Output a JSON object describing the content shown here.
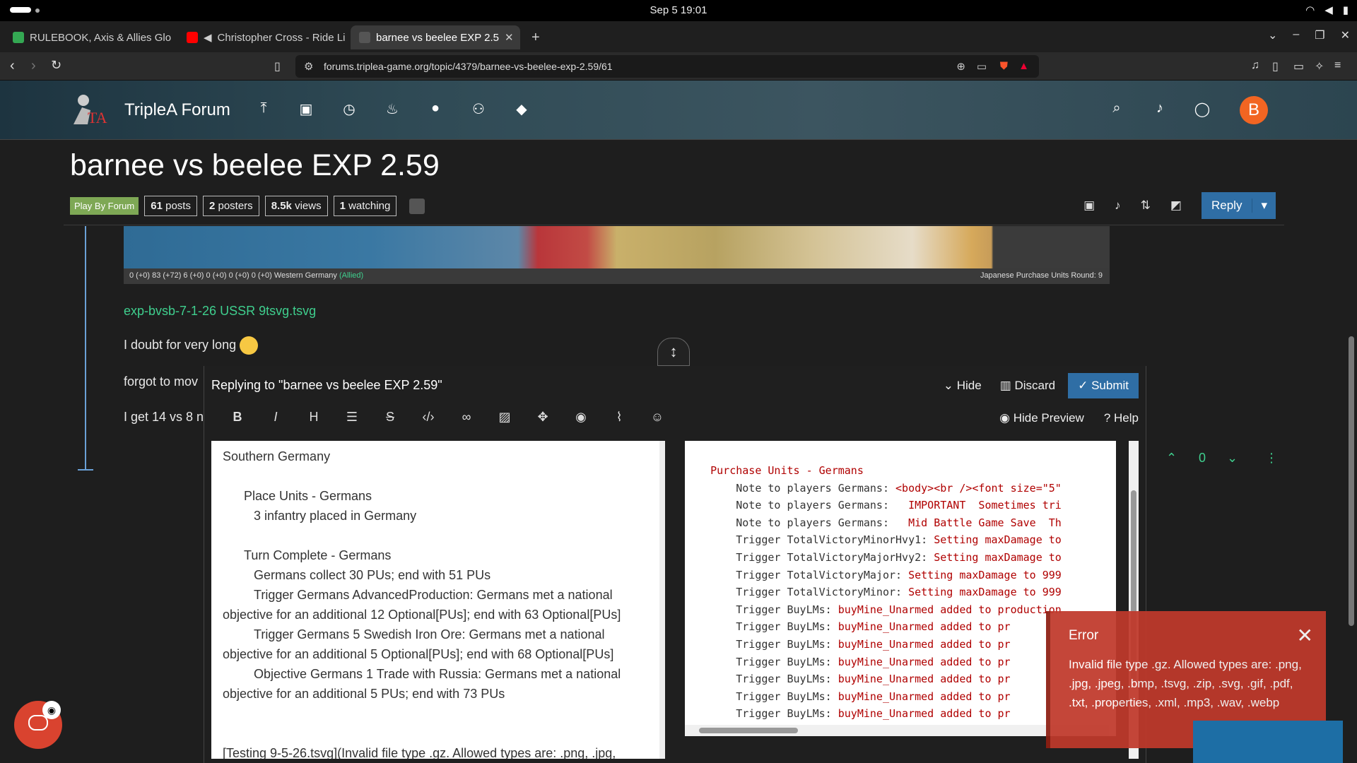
{
  "system": {
    "clock": "Sep 5  19:01"
  },
  "tabs": [
    {
      "label": "RULEBOOK, Axis & Allies Glo",
      "favcolor": "#34a853"
    },
    {
      "label": "Christopher Cross - Ride Li",
      "favcolor": "#ff0000"
    },
    {
      "label": "barnee vs beelee EXP 2.5",
      "favcolor": "#555555"
    }
  ],
  "address": {
    "url": "forums.triplea-game.org/topic/4379/barnee-vs-beelee-exp-2.59/61"
  },
  "forum": {
    "title": "TripleA Forum",
    "avatar_letter": "B"
  },
  "topic": {
    "title": "barnee vs beelee EXP 2.59",
    "category": "Play By Forum",
    "posts_count": "61",
    "posts_label": "posts",
    "posters_count": "2",
    "posters_label": "posters",
    "views_count": "8.5k",
    "views_label": "views",
    "watching_count": "1",
    "watching_label": "watching",
    "reply_label": "Reply"
  },
  "map": {
    "status": "0 (+0)   83 (+72)   6 (+0)   0 (+0)   0 (+0)   0 (+0)   Western Germany",
    "allied": "(Allied)",
    "right": "Japanese Purchase Units   Round: 9"
  },
  "post": {
    "link": "exp-bvsb-7-1-26 USSR 9tsvg.tsvg",
    "line1": "I doubt for very long",
    "line2": "forgot to mov",
    "line3": "I get 14 vs 8 n"
  },
  "post_controls": {
    "vote_count": "0"
  },
  "composer": {
    "replying": "Replying to \"barnee vs beelee EXP 2.59\"",
    "hide": "Hide",
    "discard": "Discard",
    "submit": "Submit",
    "hide_preview": "Hide Preview",
    "help": "Help",
    "editor_lines": [
      {
        "indent": 0,
        "text": "Southern Germany"
      },
      {
        "indent": 0,
        "text": ""
      },
      {
        "indent": 1,
        "text": "Place Units - Germans"
      },
      {
        "indent": 2,
        "text": "3 infantry placed in Germany"
      },
      {
        "indent": 0,
        "text": ""
      },
      {
        "indent": 1,
        "text": "Turn Complete - Germans"
      },
      {
        "indent": 2,
        "text": "Germans collect 30 PUs; end with 51 PUs"
      },
      {
        "indent": 2,
        "text": "Trigger Germans AdvancedProduction: Germans met a national"
      },
      {
        "indent": 0,
        "text": "objective for an additional 12 Optional[PUs]; end with 63 Optional[PUs]"
      },
      {
        "indent": 2,
        "text": "Trigger Germans 5 Swedish Iron Ore: Germans met a national"
      },
      {
        "indent": 0,
        "text": "objective for an additional 5 Optional[PUs]; end with 68 Optional[PUs]"
      },
      {
        "indent": 2,
        "text": "Objective Germans 1 Trade with Russia: Germans met a national"
      },
      {
        "indent": 0,
        "text": "objective for an additional 5 PUs; end with 73 PUs"
      },
      {
        "indent": 0,
        "text": ""
      },
      {
        "indent": 0,
        "text": ""
      },
      {
        "indent": 0,
        "text": "[Testing 9-5-26.tsvg](Invalid file type .gz. Allowed types are: .png, .jpg,"
      }
    ],
    "preview_lines": [
      {
        "label": "    Purchase Units - Germans",
        "value": ""
      },
      {
        "label": "        Note to players Germans: ",
        "value": "<body><br /><font size=\"5\""
      },
      {
        "label": "        Note to players Germans: ",
        "value": "  IMPORTANT  Sometimes tri"
      },
      {
        "label": "        Note to players Germans: ",
        "value": "  Mid Battle Game Save  Th"
      },
      {
        "label": "        Trigger TotalVictoryMinorHvy1: ",
        "value": "Setting maxDamage to"
      },
      {
        "label": "        Trigger TotalVictoryMajorHvy2: ",
        "value": "Setting maxDamage to"
      },
      {
        "label": "        Trigger TotalVictoryMajor: ",
        "value": "Setting maxDamage to 999"
      },
      {
        "label": "        Trigger TotalVictoryMinor: ",
        "value": "Setting maxDamage to 999"
      },
      {
        "label": "        Trigger BuyLMs: ",
        "value": "buyMine_Unarmed added to production"
      },
      {
        "label": "        Trigger BuyLMs: ",
        "value": "buyMine_Unarmed added to pr"
      },
      {
        "label": "        Trigger BuyLMs: ",
        "value": "buyMine_Unarmed added to pr"
      },
      {
        "label": "        Trigger BuyLMs: ",
        "value": "buyMine_Unarmed added to pr"
      },
      {
        "label": "        Trigger BuyLMs: ",
        "value": "buyMine_Unarmed added to pr"
      },
      {
        "label": "        Trigger BuyLMs: ",
        "value": "buyMine_Unarmed added to pr"
      },
      {
        "label": "        Trigger BuyLMs: ",
        "value": "buyMine_Unarmed added to pr"
      }
    ]
  },
  "error": {
    "title": "Error",
    "message": "Invalid file type .gz. Allowed types are: .png, .jpg, .jpeg, .bmp, .tsvg, .zip, .svg, .gif, .pdf, .txt, .properties, .xml, .mp3, .wav, .webp"
  },
  "colors": {
    "accent": "#2f6ea5",
    "link": "#3fcf8e",
    "error": "#c0392b",
    "avatar": "#f26522"
  }
}
